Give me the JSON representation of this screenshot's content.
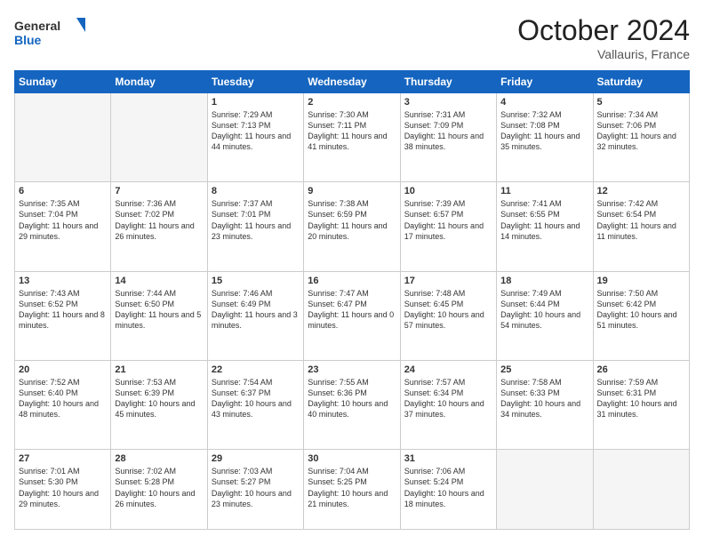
{
  "logo": {
    "line1": "General",
    "line2": "Blue"
  },
  "title": {
    "month": "October 2024",
    "location": "Vallauris, France"
  },
  "header_days": [
    "Sunday",
    "Monday",
    "Tuesday",
    "Wednesday",
    "Thursday",
    "Friday",
    "Saturday"
  ],
  "weeks": [
    [
      {
        "day": "",
        "info": ""
      },
      {
        "day": "",
        "info": ""
      },
      {
        "day": "1",
        "sunrise": "Sunrise: 7:29 AM",
        "sunset": "Sunset: 7:13 PM",
        "daylight": "Daylight: 11 hours and 44 minutes."
      },
      {
        "day": "2",
        "sunrise": "Sunrise: 7:30 AM",
        "sunset": "Sunset: 7:11 PM",
        "daylight": "Daylight: 11 hours and 41 minutes."
      },
      {
        "day": "3",
        "sunrise": "Sunrise: 7:31 AM",
        "sunset": "Sunset: 7:09 PM",
        "daylight": "Daylight: 11 hours and 38 minutes."
      },
      {
        "day": "4",
        "sunrise": "Sunrise: 7:32 AM",
        "sunset": "Sunset: 7:08 PM",
        "daylight": "Daylight: 11 hours and 35 minutes."
      },
      {
        "day": "5",
        "sunrise": "Sunrise: 7:34 AM",
        "sunset": "Sunset: 7:06 PM",
        "daylight": "Daylight: 11 hours and 32 minutes."
      }
    ],
    [
      {
        "day": "6",
        "sunrise": "Sunrise: 7:35 AM",
        "sunset": "Sunset: 7:04 PM",
        "daylight": "Daylight: 11 hours and 29 minutes."
      },
      {
        "day": "7",
        "sunrise": "Sunrise: 7:36 AM",
        "sunset": "Sunset: 7:02 PM",
        "daylight": "Daylight: 11 hours and 26 minutes."
      },
      {
        "day": "8",
        "sunrise": "Sunrise: 7:37 AM",
        "sunset": "Sunset: 7:01 PM",
        "daylight": "Daylight: 11 hours and 23 minutes."
      },
      {
        "day": "9",
        "sunrise": "Sunrise: 7:38 AM",
        "sunset": "Sunset: 6:59 PM",
        "daylight": "Daylight: 11 hours and 20 minutes."
      },
      {
        "day": "10",
        "sunrise": "Sunrise: 7:39 AM",
        "sunset": "Sunset: 6:57 PM",
        "daylight": "Daylight: 11 hours and 17 minutes."
      },
      {
        "day": "11",
        "sunrise": "Sunrise: 7:41 AM",
        "sunset": "Sunset: 6:55 PM",
        "daylight": "Daylight: 11 hours and 14 minutes."
      },
      {
        "day": "12",
        "sunrise": "Sunrise: 7:42 AM",
        "sunset": "Sunset: 6:54 PM",
        "daylight": "Daylight: 11 hours and 11 minutes."
      }
    ],
    [
      {
        "day": "13",
        "sunrise": "Sunrise: 7:43 AM",
        "sunset": "Sunset: 6:52 PM",
        "daylight": "Daylight: 11 hours and 8 minutes."
      },
      {
        "day": "14",
        "sunrise": "Sunrise: 7:44 AM",
        "sunset": "Sunset: 6:50 PM",
        "daylight": "Daylight: 11 hours and 5 minutes."
      },
      {
        "day": "15",
        "sunrise": "Sunrise: 7:46 AM",
        "sunset": "Sunset: 6:49 PM",
        "daylight": "Daylight: 11 hours and 3 minutes."
      },
      {
        "day": "16",
        "sunrise": "Sunrise: 7:47 AM",
        "sunset": "Sunset: 6:47 PM",
        "daylight": "Daylight: 11 hours and 0 minutes."
      },
      {
        "day": "17",
        "sunrise": "Sunrise: 7:48 AM",
        "sunset": "Sunset: 6:45 PM",
        "daylight": "Daylight: 10 hours and 57 minutes."
      },
      {
        "day": "18",
        "sunrise": "Sunrise: 7:49 AM",
        "sunset": "Sunset: 6:44 PM",
        "daylight": "Daylight: 10 hours and 54 minutes."
      },
      {
        "day": "19",
        "sunrise": "Sunrise: 7:50 AM",
        "sunset": "Sunset: 6:42 PM",
        "daylight": "Daylight: 10 hours and 51 minutes."
      }
    ],
    [
      {
        "day": "20",
        "sunrise": "Sunrise: 7:52 AM",
        "sunset": "Sunset: 6:40 PM",
        "daylight": "Daylight: 10 hours and 48 minutes."
      },
      {
        "day": "21",
        "sunrise": "Sunrise: 7:53 AM",
        "sunset": "Sunset: 6:39 PM",
        "daylight": "Daylight: 10 hours and 45 minutes."
      },
      {
        "day": "22",
        "sunrise": "Sunrise: 7:54 AM",
        "sunset": "Sunset: 6:37 PM",
        "daylight": "Daylight: 10 hours and 43 minutes."
      },
      {
        "day": "23",
        "sunrise": "Sunrise: 7:55 AM",
        "sunset": "Sunset: 6:36 PM",
        "daylight": "Daylight: 10 hours and 40 minutes."
      },
      {
        "day": "24",
        "sunrise": "Sunrise: 7:57 AM",
        "sunset": "Sunset: 6:34 PM",
        "daylight": "Daylight: 10 hours and 37 minutes."
      },
      {
        "day": "25",
        "sunrise": "Sunrise: 7:58 AM",
        "sunset": "Sunset: 6:33 PM",
        "daylight": "Daylight: 10 hours and 34 minutes."
      },
      {
        "day": "26",
        "sunrise": "Sunrise: 7:59 AM",
        "sunset": "Sunset: 6:31 PM",
        "daylight": "Daylight: 10 hours and 31 minutes."
      }
    ],
    [
      {
        "day": "27",
        "sunrise": "Sunrise: 7:01 AM",
        "sunset": "Sunset: 5:30 PM",
        "daylight": "Daylight: 10 hours and 29 minutes."
      },
      {
        "day": "28",
        "sunrise": "Sunrise: 7:02 AM",
        "sunset": "Sunset: 5:28 PM",
        "daylight": "Daylight: 10 hours and 26 minutes."
      },
      {
        "day": "29",
        "sunrise": "Sunrise: 7:03 AM",
        "sunset": "Sunset: 5:27 PM",
        "daylight": "Daylight: 10 hours and 23 minutes."
      },
      {
        "day": "30",
        "sunrise": "Sunrise: 7:04 AM",
        "sunset": "Sunset: 5:25 PM",
        "daylight": "Daylight: 10 hours and 21 minutes."
      },
      {
        "day": "31",
        "sunrise": "Sunrise: 7:06 AM",
        "sunset": "Sunset: 5:24 PM",
        "daylight": "Daylight: 10 hours and 18 minutes."
      },
      {
        "day": "",
        "info": ""
      },
      {
        "day": "",
        "info": ""
      }
    ]
  ]
}
